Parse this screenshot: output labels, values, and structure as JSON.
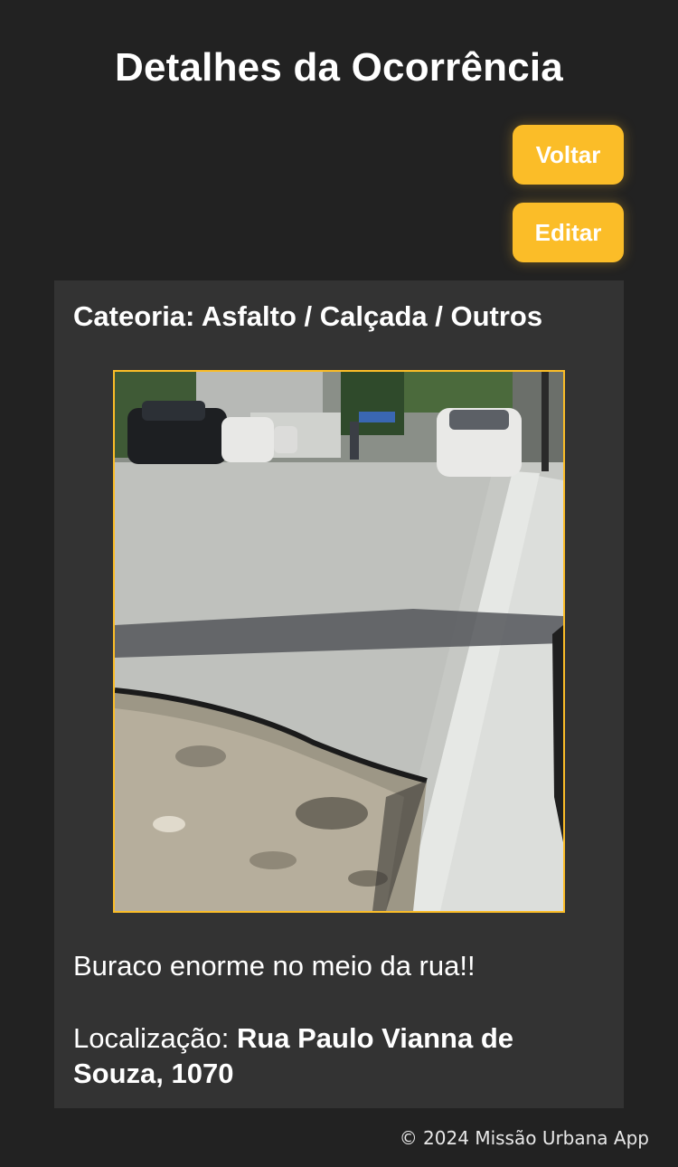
{
  "header": {
    "title": "Detalhes da Ocorrência"
  },
  "actions": {
    "back_label": "Voltar",
    "edit_label": "Editar"
  },
  "occurrence": {
    "category": "Cateoria: Asfalto / Calçada / Outros",
    "photo_description": "Foto da ocorrência: buraco no asfalto",
    "description": "Buraco enorme no meio da rua!!",
    "location_label": "Localização: ",
    "location_value": "Rua Paulo Vianna de Souza, 1070"
  },
  "footer": {
    "copyright": "© 2024 Missão Urbana App"
  },
  "colors": {
    "background": "#222222",
    "card": "#333333",
    "accent": "#fbbd28",
    "text": "#ffffff"
  }
}
